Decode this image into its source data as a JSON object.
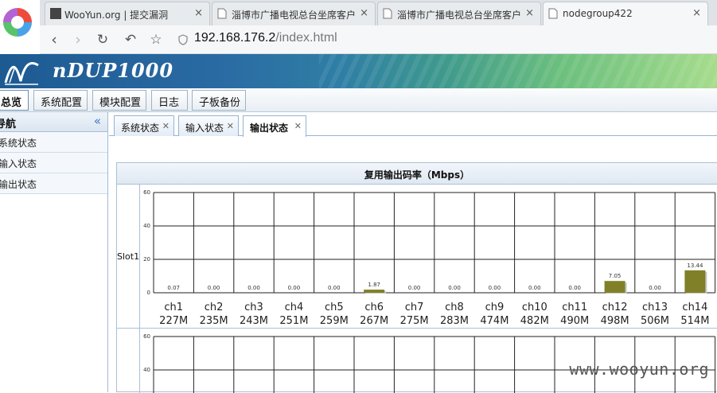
{
  "browser": {
    "tabs": [
      {
        "title": "WooYun.org | 提交漏洞",
        "active": false,
        "icon": "wooyun-favicon"
      },
      {
        "title": "淄博市广播电视总台坐席客户",
        "active": false,
        "icon": "page-icon"
      },
      {
        "title": "淄博市广播电视总台坐席客户",
        "active": false,
        "icon": "page-icon"
      },
      {
        "title": "nodegroup422",
        "active": true,
        "icon": "page-icon"
      }
    ],
    "url_host": "192.168.176.2",
    "url_path": "/index.html"
  },
  "app": {
    "brand": "nDUP1000",
    "menu": [
      "总览",
      "系统配置",
      "模块配置",
      "日志",
      "子板备份"
    ],
    "menu_active": 0
  },
  "sidebar": {
    "title": "导航",
    "collapse_icon": "double-chevron-left-icon",
    "items": [
      "系统状态",
      "输入状态",
      "输出状态"
    ]
  },
  "content_tabs": [
    {
      "label": "系统状态",
      "active": false
    },
    {
      "label": "输入状态",
      "active": false
    },
    {
      "label": "输出状态",
      "active": true
    }
  ],
  "panel": {
    "title": "复用输出码率（Mbps）"
  },
  "chart_data": [
    {
      "type": "bar",
      "label": "Slot1",
      "ylim": [
        0,
        60
      ],
      "yticks": [
        "60",
        "40",
        "20",
        "0"
      ],
      "grid": true,
      "color": "#808028",
      "categories": [
        "ch1",
        "ch2",
        "ch3",
        "ch4",
        "ch5",
        "ch6",
        "ch7",
        "ch8",
        "ch9",
        "ch10",
        "ch11",
        "ch12",
        "ch13",
        "ch14"
      ],
      "freqs": [
        "227M",
        "235M",
        "243M",
        "251M",
        "259M",
        "267M",
        "275M",
        "283M",
        "474M",
        "482M",
        "490M",
        "498M",
        "506M",
        "514M"
      ],
      "values": [
        0.07,
        0.0,
        0.0,
        0.0,
        0.0,
        1.87,
        0.0,
        0.0,
        0.0,
        0.0,
        0.0,
        7.05,
        0.0,
        13.44
      ],
      "value_labels": [
        "0.07",
        "0.00",
        "0.00",
        "0.00",
        "0.00",
        "1.87",
        "0.00",
        "0.00",
        "0.00",
        "0.00",
        "0.00",
        "7.05",
        "0.00",
        "13.44"
      ]
    },
    {
      "type": "bar",
      "label": "",
      "ylim": [
        0,
        60
      ],
      "yticks": [
        "60",
        "40"
      ],
      "grid": true
    }
  ],
  "watermark": "www.wooyun.org"
}
